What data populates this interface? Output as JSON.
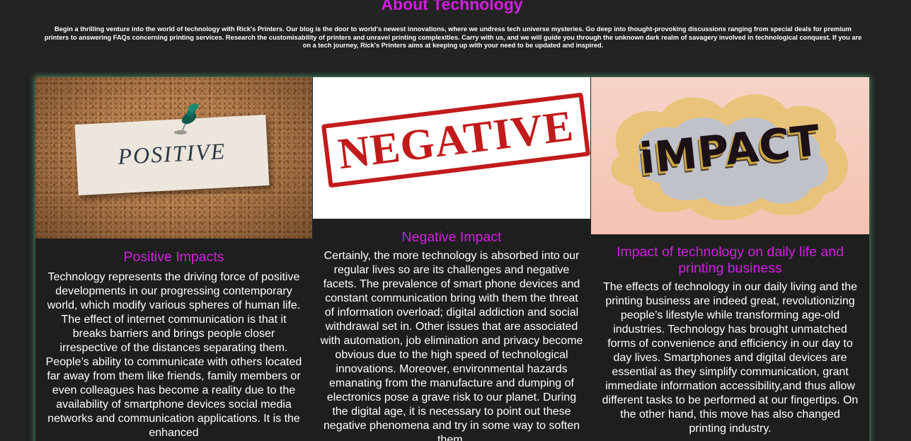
{
  "header": {
    "title": "About Technology",
    "intro": "Begin a thrilling venture into the world of technology with Rick's Printers. Our blog is the door to world's newest innovations, where we undress tech universe mysteries. Go deep into thought-provoking discussions ranging from special deals for premium printers to answering FAQs concerning printing services. Research the customisability of printers and unravel printing complexities. Carry with us, and we will guide you through the unknown dark realm of savagery involved in technological conquest. If you are on a tech journey, Rick's Printers aims at keeping up with your need to be updated and inspired."
  },
  "cards": [
    {
      "image_word": "POSITIVE",
      "title": "Positive Impacts",
      "text": "Technology represents the driving force of positive developments in our progressing contemporary world, which modify various spheres of human life. The effect of internet communication is that it breaks barriers and brings people closer irrespective of the distances separating them. People’s ability to communicate with others located far away from them like friends, family members or even colleagues has become a reality due to the availability of smartphone devices social media networks and communication applications. It is the enhanced"
    },
    {
      "image_word": "NEGATIVE",
      "title": "Negative Impact",
      "text": "Certainly, the more technology is absorbed into our regular lives so are its challenges and negative facets. The prevalence of smart phone devices and constant communication bring with them the threat of information overload; digital addiction and social withdrawal set in. Other issues that are associated with automation, job elimination and privacy become obvious due to the high speed of technological innovations. Moreover, environmental hazards emanating from the manufacture and dumping of electronics pose a grave risk to our planet. During the digital age, it is necessary to point out these negative phenomena and try in some way to soften them."
    },
    {
      "image_word": "iMPACT",
      "title": "Impact of technology on daily life and printing business",
      "text": "The effects of technology in our daily living and the printing business are indeed great, revolutionizing people’s lifestyle while transforming age-old industries. Technology has brought unmatched forms of convenience and efficiency in our day to day lives. Smartphones and digital devices are essential as they simplify communication, grant immediate information accessibility,and thus allow different tasks to be performed at our fingertips. On the other hand, this move has also changed printing industry."
    }
  ],
  "colors": {
    "background": "#232323",
    "accent": "#d21ee0",
    "card_glow": "#5fe696",
    "stamp_red": "#c21b1b"
  }
}
